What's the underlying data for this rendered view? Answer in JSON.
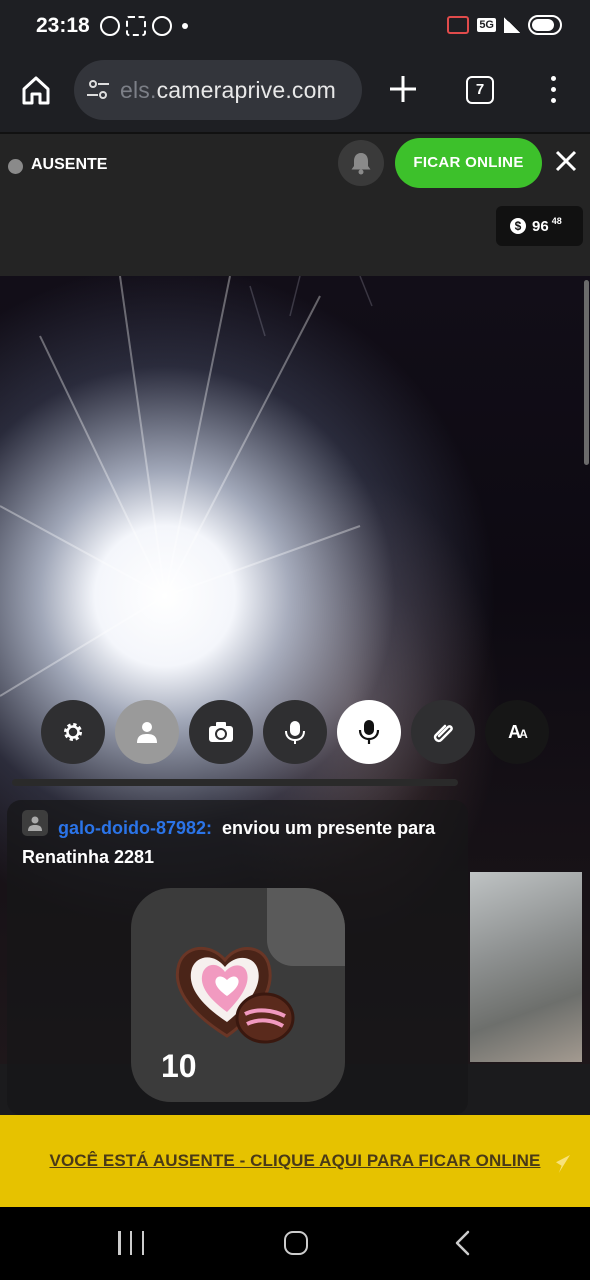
{
  "status_bar": {
    "time": "23:18",
    "network": "5G",
    "icons": [
      "whatsapp-icon",
      "screenshot-icon",
      "whatsapp-icon",
      "dot-icon",
      "cast-icon",
      "signal-icon",
      "battery-icon"
    ]
  },
  "browser": {
    "url_faded": "els.",
    "url_main": "cameraprive.com",
    "tab_count": "7"
  },
  "header": {
    "status_label": "AUSENTE",
    "online_button": "FICAR ONLINE",
    "balance_main": "96",
    "balance_cents": "48"
  },
  "controls": [
    {
      "name": "settings",
      "icon": "gear-icon"
    },
    {
      "name": "profile",
      "icon": "person-icon"
    },
    {
      "name": "switch-camera",
      "icon": "camera-switch-icon"
    },
    {
      "name": "voice-effects",
      "icon": "mic-effects-icon"
    },
    {
      "name": "microphone",
      "icon": "mic-icon"
    },
    {
      "name": "attach",
      "icon": "paperclip-icon"
    },
    {
      "name": "text-size",
      "icon": "font-size-icon",
      "label": "A",
      "label_small": "A"
    }
  ],
  "chat": {
    "username": "galo-doido-87982:",
    "message": "enviou um presente para Renatinha 2281",
    "gift_count": "10"
  },
  "banner": {
    "text": "VOCÊ ESTÁ AUSENTE - CLIQUE AQUI PARA FICAR ONLINE"
  },
  "colors": {
    "online_green": "#3dc12b",
    "banner_yellow": "#e6c200",
    "username_blue": "#2b74e8"
  }
}
